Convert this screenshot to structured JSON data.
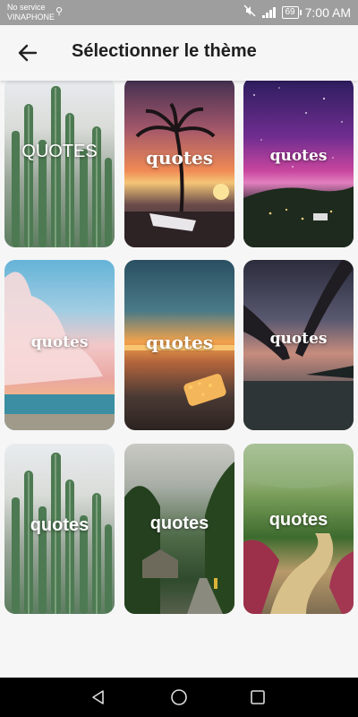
{
  "status_bar": {
    "carrier_line1": "No service",
    "carrier_line2": "VINAPHONE",
    "battery": "69",
    "time": "7:00 AM",
    "icons": [
      "usb-icon",
      "mute-icon",
      "signal-icon",
      "battery-icon"
    ]
  },
  "app_bar": {
    "back_icon": "arrow-left-icon",
    "title": "Sélectionner le thème"
  },
  "themes": [
    {
      "label": "QUOTES",
      "theme": "cactus"
    },
    {
      "label": "quotes",
      "theme": "palm-sunset"
    },
    {
      "label": "quotes",
      "theme": "galaxy"
    },
    {
      "label": "quotes",
      "theme": "pink-clouds-beach"
    },
    {
      "label": "quotes",
      "theme": "bottle-lights-sunset"
    },
    {
      "label": "quotes",
      "theme": "holding-hands"
    },
    {
      "label": "quotes",
      "theme": "cactus"
    },
    {
      "label": "quotes",
      "theme": "forest-path"
    },
    {
      "label": "quotes",
      "theme": "garden-path"
    }
  ],
  "nav_bar": {
    "back": "triangle-back-icon",
    "home": "circle-home-icon",
    "recents": "square-recents-icon"
  },
  "colors": {
    "status_bar": "#9e9e9e",
    "app_bar": "#f6f6f6",
    "nav_bar": "#000000"
  }
}
